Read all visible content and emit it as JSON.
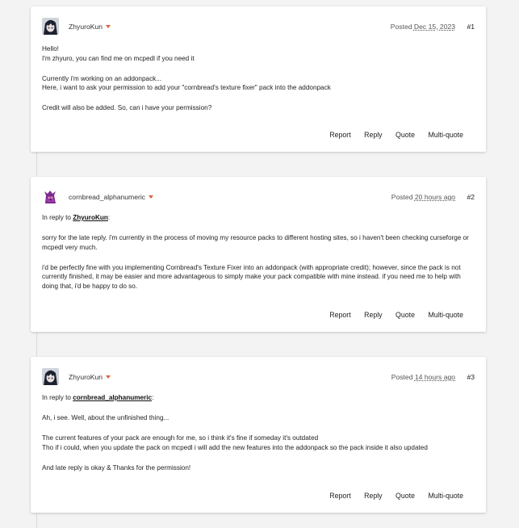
{
  "posts": [
    {
      "author": "ZhyuroKun",
      "posted_label": "Posted",
      "date": "Dec 15, 2023",
      "number": "#1",
      "reply_prefix": "",
      "reply_to": "",
      "paragraphs": [
        [
          "Hello!",
          "I'm zhyuro, you can find me on mcpedl if you need it"
        ],
        [
          "Currently i'm working on an addonpack...",
          "Here, i want to ask your permission to add your \"cornbread's texture fixer\" pack into the addonpack"
        ],
        [
          "Credit will also be added. So, can i have your permission?"
        ]
      ]
    },
    {
      "author": "cornbread_alphanumeric",
      "posted_label": "Posted",
      "date": "20 hours ago",
      "number": "#2",
      "reply_prefix": "In reply to",
      "reply_to": "ZhyuroKun",
      "paragraphs": [
        [
          "sorry for the late reply. i'm currently in the process of moving my resource packs to different hosting sites, so i haven't been checking curseforge or mcpedl very much."
        ],
        [
          "i'd be perfectly fine with you implementing Cornbread's Texture Fixer into an addonpack (with appropriate credit); however, since the pack is not currently finished, it may be easier and more advantageous to simply make your pack compatible with mine instead. if you need me to help with doing that, i'd be happy to do so."
        ]
      ]
    },
    {
      "author": "ZhyuroKun",
      "posted_label": "Posted",
      "date": "14 hours ago",
      "number": "#3",
      "reply_prefix": "In reply to",
      "reply_to": "cornbread_alphanumeric",
      "paragraphs": [
        [
          "Ah, i see. Well, about the unfinished thing..."
        ],
        [
          "The current features of your pack are enough for me, so i think it's fine if someday it's outdated",
          "Tho if i could, when you update the pack on mcpedl i will add the new features into the addonpack so the pack inside it also updated"
        ],
        [
          "And late reply is okay & Thanks for the permission!"
        ]
      ]
    }
  ],
  "actions": {
    "report": "Report",
    "reply": "Reply",
    "quote": "Quote",
    "multiquote": "Multi-quote"
  }
}
